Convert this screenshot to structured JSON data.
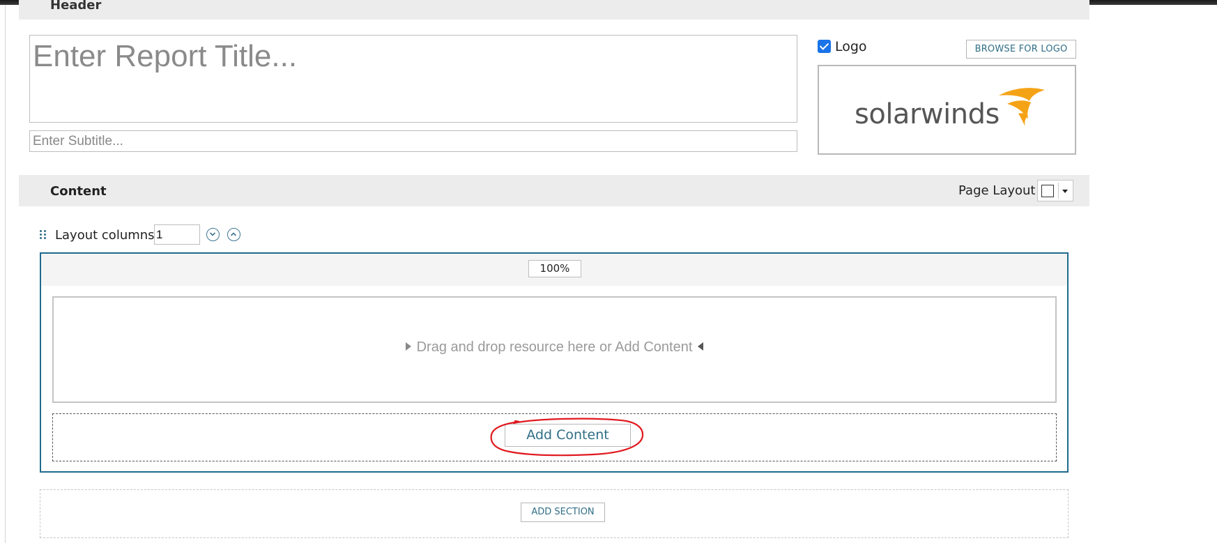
{
  "header": {
    "title": "Header",
    "report_title_placeholder": "Enter Report Title...",
    "subtitle_placeholder": "Enter Subtitle...",
    "logo_checkbox_checked": true,
    "logo_label": "Logo",
    "browse_logo_label": "BROWSE FOR LOGO",
    "logo_text": "solarwinds",
    "logo_flame_color": "#f5a316"
  },
  "content": {
    "title": "Content",
    "page_layout_label": "Page Layout",
    "layout_columns_label": "Layout columns",
    "layout_columns_value": "1",
    "column_width": "100%",
    "drop_text": "Drag and drop resource here or Add Content",
    "add_content_label": "Add Content",
    "add_section_label": "ADD SECTION"
  },
  "colors": {
    "accent": "#2f6e86",
    "section_border": "#1e6a8c",
    "bar_bg": "#ececec",
    "annotation": "#e0191f"
  }
}
